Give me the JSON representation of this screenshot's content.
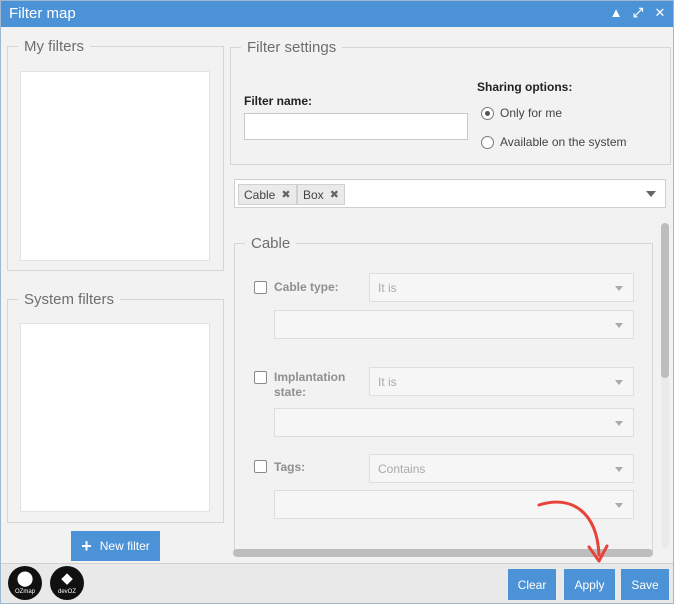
{
  "window": {
    "title": "Filter map"
  },
  "left": {
    "my_filters_title": "My filters",
    "system_filters_title": "System filters",
    "new_filter_label": "New filter"
  },
  "settings": {
    "title": "Filter settings",
    "filter_name_label": "Filter name:",
    "filter_name_value": "",
    "sharing_title": "Sharing options:",
    "sharing_options": [
      {
        "label": "Only for me",
        "selected": true
      },
      {
        "label": "Available on the system",
        "selected": false
      }
    ]
  },
  "tags": [
    {
      "label": "Cable"
    },
    {
      "label": "Box"
    }
  ],
  "cable_section": {
    "title": "Cable",
    "fields": [
      {
        "label": "Cable type:",
        "operator": "It is",
        "value": ""
      },
      {
        "label": "Implantation state:",
        "operator": "It is",
        "value": ""
      },
      {
        "label": "Tags:",
        "operator": "Contains",
        "value": ""
      }
    ]
  },
  "footer": {
    "logos": [
      "OZmap",
      "devOZ"
    ],
    "clear_label": "Clear",
    "apply_label": "Apply",
    "save_label": "Save"
  },
  "colors": {
    "accent": "#4c92d6",
    "annotation_arrow": "#e8433a"
  }
}
